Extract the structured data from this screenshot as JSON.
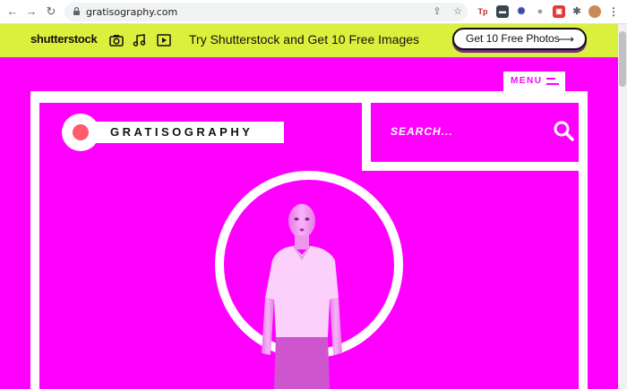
{
  "browser": {
    "url": "gratisography.com",
    "extensions": [
      {
        "name": "tp-extension-icon",
        "label": "Tp",
        "color": "#c62828"
      },
      {
        "name": "dark-extension-icon",
        "label": "▬",
        "color": "#37474f"
      },
      {
        "name": "settings-extension-icon",
        "label": "✺",
        "color": "#3949ab"
      },
      {
        "name": "grey-extension-icon",
        "label": "●",
        "color": "#9e9e9e"
      },
      {
        "name": "red-extension-icon",
        "label": "▣",
        "color": "#e53935"
      }
    ]
  },
  "banner": {
    "brand": "shutterstock",
    "headline": "Try Shutterstock and Get 10 Free Images",
    "cta": "Get 10 Free Photos",
    "background": "#dbf03c",
    "cta_shadow": "#7a2d8c"
  },
  "site": {
    "menu_label": "MENU",
    "logo_text": "GRATISOGRAPHY",
    "search_placeholder": "SEARCH...",
    "accent": "#ff00ff",
    "logo_dot": "#ff5b6b"
  }
}
